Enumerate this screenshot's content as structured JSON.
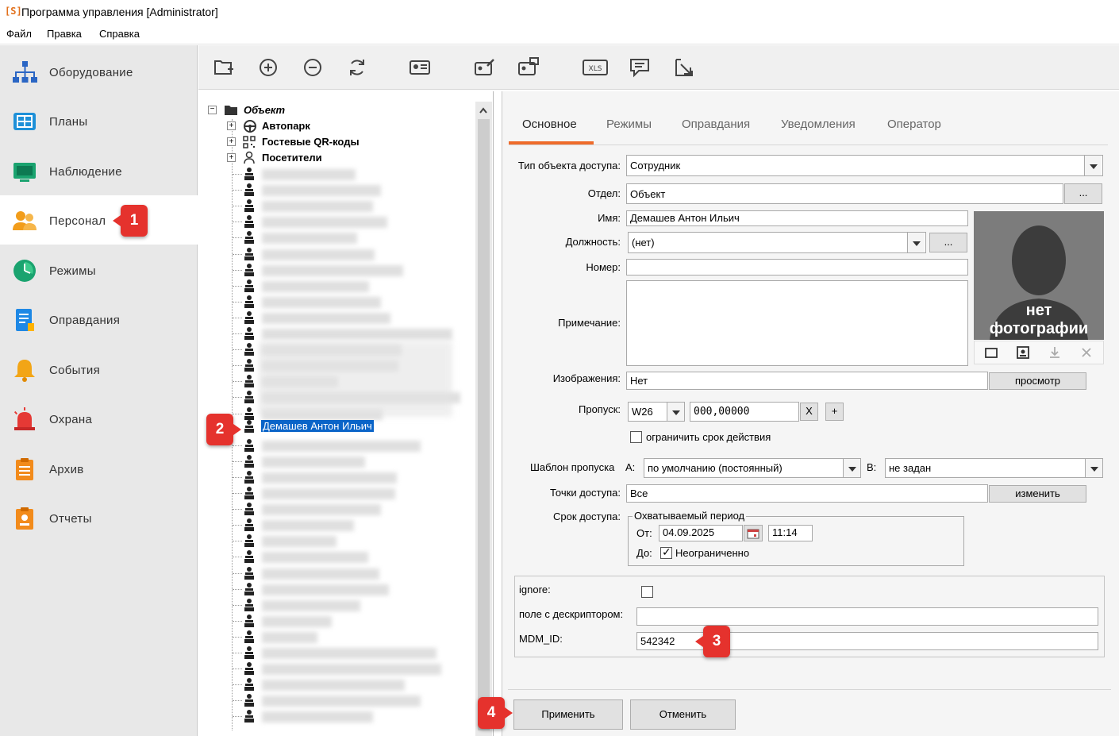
{
  "window": {
    "logo": "[S]",
    "title": "Программа управления [Administrator]"
  },
  "menu": [
    "Файл",
    "Правка",
    "Справка"
  ],
  "nav": [
    {
      "label": "Оборудование",
      "icon": "network-icon"
    },
    {
      "label": "Планы",
      "icon": "plans-icon"
    },
    {
      "label": "Наблюдение",
      "icon": "monitor-icon"
    },
    {
      "label": "Персонал",
      "icon": "personnel-icon",
      "active": true
    },
    {
      "label": "Режимы",
      "icon": "clock-icon"
    },
    {
      "label": "Оправдания",
      "icon": "document-icon"
    },
    {
      "label": "События",
      "icon": "bell-icon"
    },
    {
      "label": "Охрана",
      "icon": "alarm-icon"
    },
    {
      "label": "Архив",
      "icon": "archive-icon"
    },
    {
      "label": "Отчеты",
      "icon": "report-icon"
    }
  ],
  "toolbar_icons": [
    "add-folder-icon",
    "add-icon",
    "remove-icon",
    "refresh-icon",
    "id-card-icon",
    "edit-card-icon",
    "transfer-card-icon",
    "xls-icon",
    "message-icon",
    "export-icon"
  ],
  "tree": {
    "root": "Объект",
    "groups": [
      "Автопарк",
      "Гостевые QR-коды",
      "Посетители"
    ],
    "selected": "Демашев Антон Ильич"
  },
  "tabs": [
    "Основное",
    "Режимы",
    "Оправдания",
    "Уведомления",
    "Оператор"
  ],
  "form": {
    "access_type_label": "Тип объекта доступа:",
    "access_type": "Сотрудник",
    "department_label": "Отдел:",
    "department": "Объект",
    "ellipsis": "...",
    "name_label": "Имя:",
    "name": "Демашев Антон Ильич",
    "position_label": "Должность:",
    "position": "(нет)",
    "number_label": "Номер:",
    "number": "",
    "note_label": "Примечание:",
    "note": "",
    "images_label": "Изображения:",
    "images": "Нет",
    "view_button": "просмотр",
    "pass_label": "Пропуск:",
    "pass_type": "W26",
    "pass_code": "000,00000",
    "clear_btn": "X",
    "add_btn": "+",
    "limit_label": "ограничить срок действия",
    "template_label": "Шаблон пропуска",
    "a_label": "А:",
    "template_a": "по умолчанию (постоянный)",
    "b_label": "В:",
    "template_b": "не задан",
    "points_label": "Точки доступа:",
    "points": "Все",
    "change_button": "изменить",
    "term_label": "Срок доступа:",
    "period_title": "Охватываемый период",
    "from_label": "От:",
    "from_date": "04.09.2025",
    "from_time": "11:14",
    "to_label": "До:",
    "unlimited": "Неограниченно",
    "photo_text_1": "нет",
    "photo_text_2": "фотографии"
  },
  "extra": {
    "ignore_label": "ignore:",
    "descriptor_label": "поле с дескриптором:",
    "descriptor": "",
    "mdm_label": "MDM_ID:",
    "mdm": "542342"
  },
  "buttons": {
    "apply": "Применить",
    "cancel": "Отменить"
  },
  "badges": [
    "1",
    "2",
    "3",
    "4"
  ],
  "colors": {
    "accent": "#ee6b2b",
    "badge": "#e5322d",
    "selection": "#0a64c8"
  }
}
